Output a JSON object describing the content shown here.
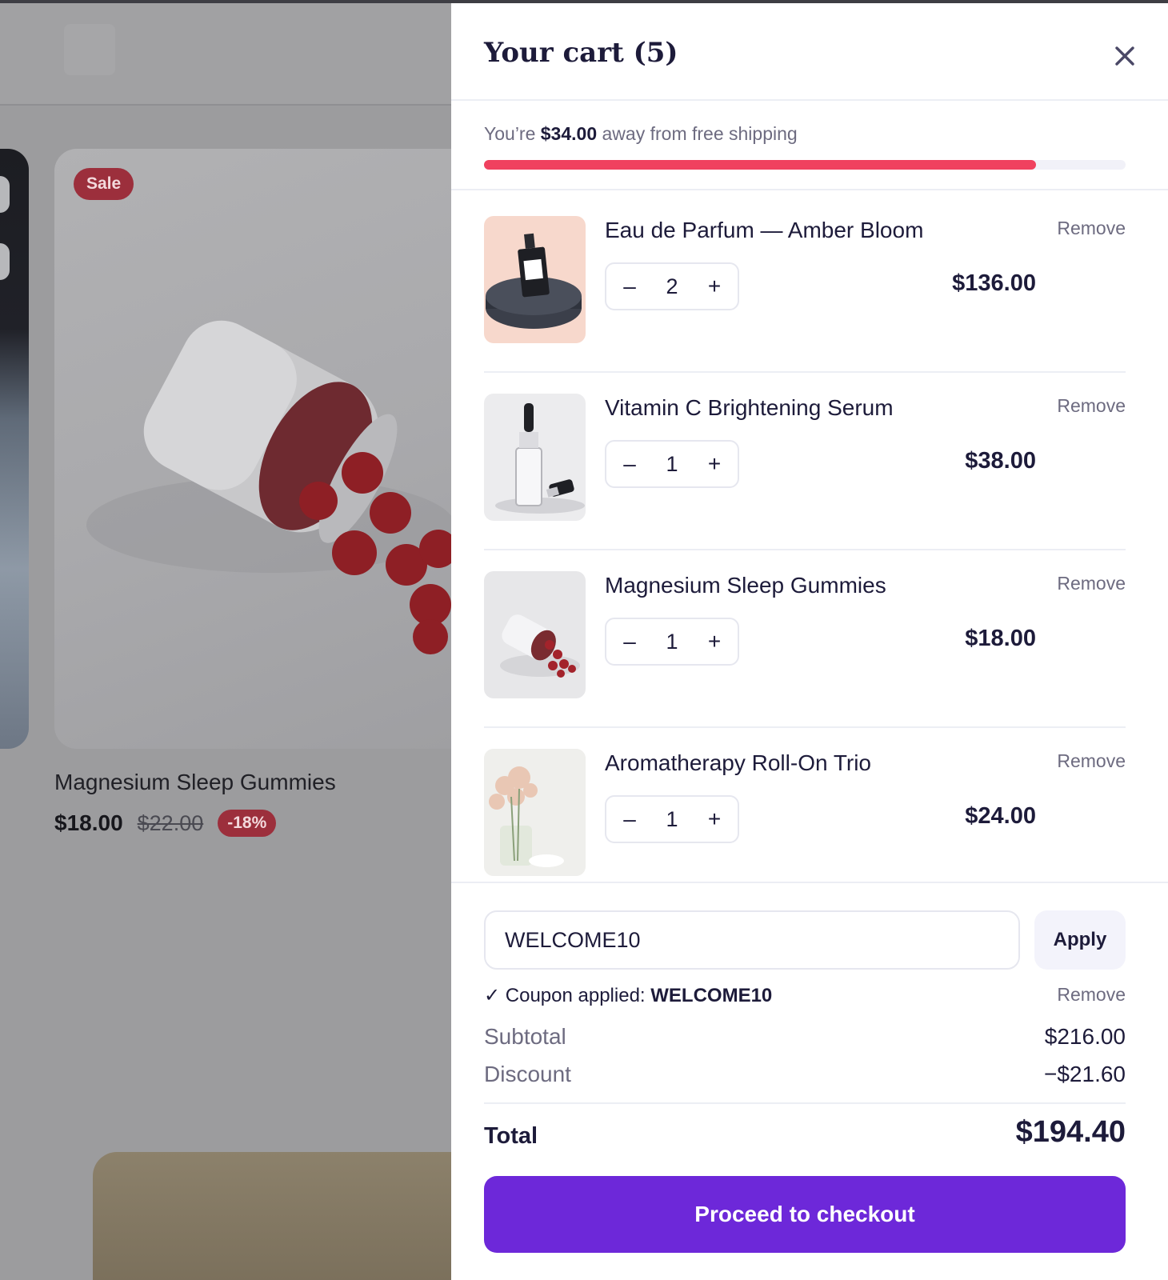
{
  "background": {
    "sale_badge": "Sale",
    "product": {
      "title": "Magnesium Sleep Gummies",
      "price": "$18.00",
      "original_price": "$22.00",
      "discount_badge": "-18%"
    }
  },
  "cart": {
    "title": "Your cart (5)",
    "close_icon": "close-icon",
    "shipping": {
      "prefix": "You’re ",
      "amount": "$34.00",
      "suffix": " away from free shipping",
      "progress": 0.86,
      "progress_color": "#f0415f"
    },
    "items": [
      {
        "name": "Eau de Parfum — Amber Bloom",
        "quantity": "2",
        "price": "$136.00",
        "remove_label": "Remove",
        "decrement": "–",
        "increment": "+"
      },
      {
        "name": "Vitamin C Brightening Serum",
        "quantity": "1",
        "price": "$38.00",
        "remove_label": "Remove",
        "decrement": "–",
        "increment": "+"
      },
      {
        "name": "Magnesium Sleep Gummies",
        "quantity": "1",
        "price": "$18.00",
        "remove_label": "Remove",
        "decrement": "–",
        "increment": "+"
      },
      {
        "name": "Aromatherapy Roll-On Trio",
        "quantity": "1",
        "price": "$24.00",
        "remove_label": "Remove",
        "decrement": "–",
        "increment": "+"
      }
    ],
    "coupon": {
      "value": "WELCOME10",
      "apply_label": "Apply",
      "status_prefix": "✓ Coupon applied: ",
      "status_code": "WELCOME10",
      "remove_label": "Remove"
    },
    "summary": {
      "subtotal_label": "Subtotal",
      "subtotal_value": "$216.00",
      "discount_label": "Discount",
      "discount_value": "−$21.60",
      "total_label": "Total",
      "total_value": "$194.40"
    },
    "checkout_label": "Proceed to checkout",
    "accent_color": "#6d28d9"
  }
}
